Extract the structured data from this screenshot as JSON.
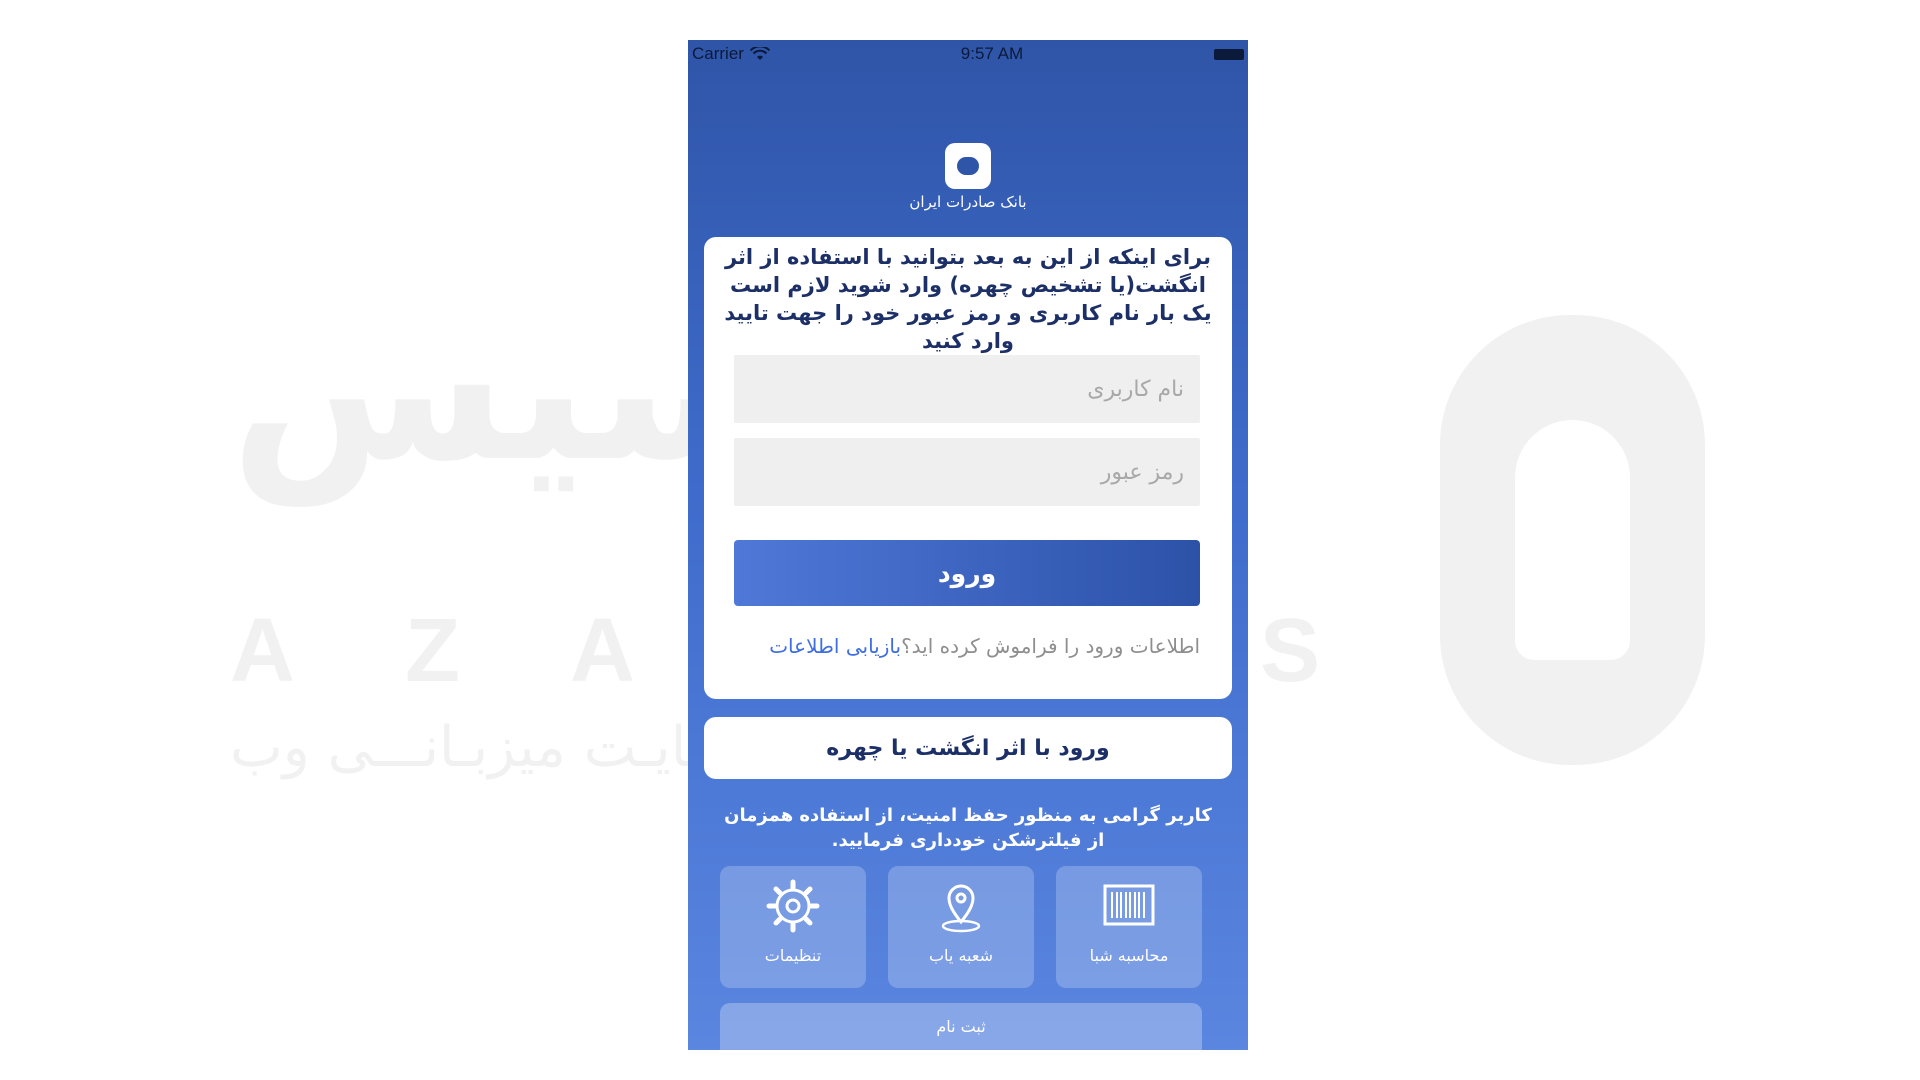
{
  "watermark": {
    "persian_title": "آذرسیس",
    "latin": "AZARSYS",
    "tagline": "ســرعــت بـی نهایـت میزبـانـــی وب"
  },
  "status_bar": {
    "carrier": "Carrier",
    "time": "9:57 AM"
  },
  "bank": {
    "name": "بانک صادرات ایران"
  },
  "login": {
    "intro": "برای اینکه از این به بعد بتوانید با استفاده از اثر انگشت(یا تشخیص چهره) وارد شوید لازم است یک بار نام کاربری و رمز عبور خود را جهت تایید وارد کنید",
    "username_placeholder": "نام کاربری",
    "password_placeholder": "رمز عبور",
    "submit_label": "ورود",
    "forgot_text": "اطلاعات ورود را فراموش کرده اید؟",
    "forgot_link": "بازیابی اطلاعات"
  },
  "biometric": {
    "label": "ورود با اثر انگشت یا چهره"
  },
  "notice": "کاربر گرامی به منظور حفظ امنیت، از استفاده همزمان از فیلترشکن خودداری فرمایید.",
  "tiles": [
    {
      "label": "تنظیمات",
      "icon": "gear-icon"
    },
    {
      "label": "شعبه یاب",
      "icon": "map-pin-icon"
    },
    {
      "label": "محاسبه شبا",
      "icon": "barcode-icon"
    }
  ],
  "register": {
    "label": "ثبت نام"
  },
  "colors": {
    "primary": "#2f55a8",
    "accent_link": "#3d6de0",
    "text_dark": "#1c2f66"
  }
}
